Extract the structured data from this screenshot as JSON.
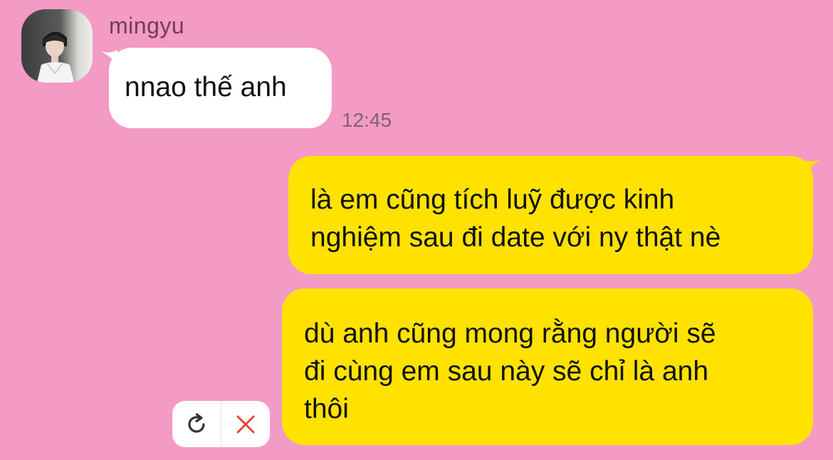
{
  "chat": {
    "sender": {
      "name": "mingyu",
      "avatar_icon": "profile-photo"
    },
    "messages": [
      {
        "direction": "incoming",
        "text": "nnao thế anh",
        "time": "12:45"
      },
      {
        "direction": "outgoing",
        "lines": [
          "là em cũng tích luỹ được kinh",
          "nghiệm sau đi date với ny thật nè"
        ]
      },
      {
        "direction": "outgoing",
        "status": "failed",
        "lines": [
          "dù anh cũng mong rằng người sẽ",
          "đi cùng em sau này sẽ chỉ là anh",
          "thôi"
        ]
      }
    ],
    "failed_actions": {
      "retry_icon": "refresh-icon",
      "delete_icon": "close-icon"
    }
  },
  "colors": {
    "background": "#f39ac5",
    "incoming_bubble": "#ffffff",
    "outgoing_bubble": "#ffe200",
    "name_text": "#6f3d5b",
    "time_text": "#7e6273",
    "delete_icon": "#e0483a"
  }
}
